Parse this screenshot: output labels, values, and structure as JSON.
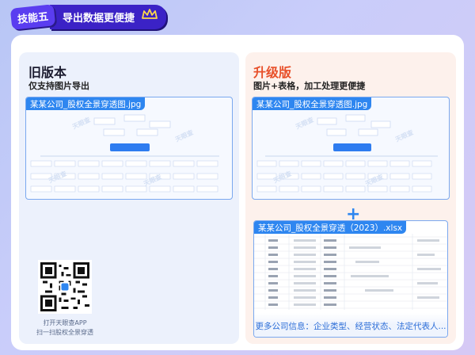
{
  "header": {
    "skill_tag": "技能五",
    "title": "导出数据更便捷"
  },
  "old_version": {
    "heading": "旧版本",
    "subtitle": "仅支持图片导出",
    "file_name": "某某公司_股权全景穿透图.jpg",
    "qr_caption_line1": "打开天眼查APP",
    "qr_caption_line2": "扫一扫股权全景穿透"
  },
  "new_version": {
    "heading": "升级版",
    "subtitle": "图片+表格，加工处理更便捷",
    "image_file_name": "某某公司_股权全景穿透图.jpg",
    "plus_sign": "+",
    "excel_file_name": "某某公司_股权全景穿透（2023）.xlsx",
    "more_info": "更多公司信息：企业类型、经营状态、法定代表人..."
  },
  "colors": {
    "accent_blue": "#2e86f0",
    "upgrade_orange": "#e8502a",
    "brand_purple": "#3b22c6"
  }
}
